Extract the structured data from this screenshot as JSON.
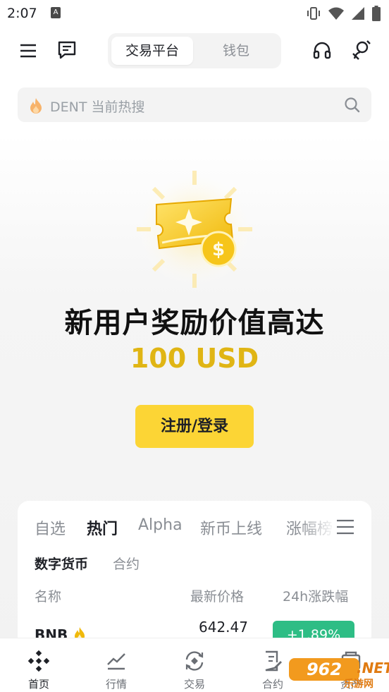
{
  "status_bar": {
    "time": "2:07",
    "notif_letter": "A"
  },
  "header": {
    "tabs": [
      {
        "label": "交易平台",
        "active": true
      },
      {
        "label": "钱包",
        "active": false
      }
    ]
  },
  "search": {
    "placeholder": "DENT 当前热搜"
  },
  "promo": {
    "title": "新用户奖励价值高达",
    "amount": "100 USD",
    "cta_label": "注册/登录"
  },
  "market": {
    "tabs": [
      {
        "label": "自选",
        "active": false
      },
      {
        "label": "热门",
        "active": true
      },
      {
        "label": "Alpha",
        "active": false
      },
      {
        "label": "新币上线",
        "active": false
      },
      {
        "label": "涨幅榜",
        "active": false
      }
    ],
    "subtabs": [
      {
        "label": "数字货币",
        "active": true
      },
      {
        "label": "合约",
        "active": false
      }
    ],
    "columns": {
      "name": "名称",
      "price": "最新价格",
      "change": "24h涨跌幅"
    },
    "rows": [
      {
        "symbol": "BNB",
        "price": "642.47",
        "change": "+1.89%"
      }
    ]
  },
  "bottom_nav": [
    {
      "label": "首页",
      "icon": "binance-logo-icon",
      "active": true
    },
    {
      "label": "行情",
      "icon": "chart-trend-icon",
      "active": false
    },
    {
      "label": "交易",
      "icon": "trade-exchange-icon",
      "active": false
    },
    {
      "label": "合约",
      "icon": "contract-doc-icon",
      "active": false
    },
    {
      "label": "资产",
      "icon": "wallet-icon",
      "active": false
    }
  ],
  "watermark": {
    "brand": "962",
    "suffix": ".NET",
    "sub": "乐游网"
  },
  "colors": {
    "brand_yellow": "#fcd535",
    "amount_gold": "#e0b514",
    "positive_green": "#2ebd85",
    "text_primary": "#1e2026",
    "text_secondary": "#8a8e94"
  }
}
